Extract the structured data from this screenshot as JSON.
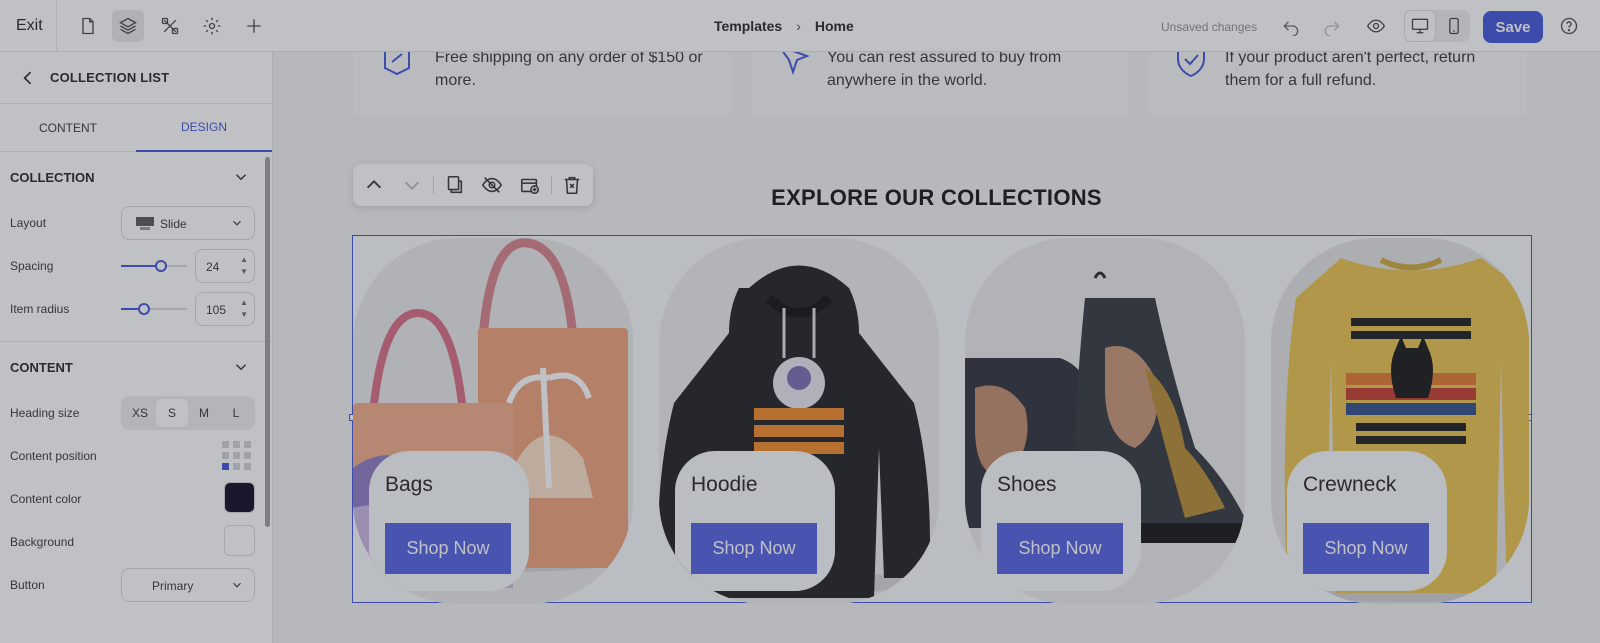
{
  "topbar": {
    "exit_label": "Exit",
    "breadcrumb": {
      "parent": "Templates",
      "current": "Home"
    },
    "unsaved_label": "Unsaved changes",
    "save_label": "Save",
    "help_label": "?"
  },
  "sidebar": {
    "title": "COLLECTION LIST",
    "tabs": [
      {
        "label": "CONTENT"
      },
      {
        "label": "DESIGN"
      }
    ],
    "collection_section": {
      "title": "COLLECTION",
      "layout": {
        "label": "Layout",
        "value": "Slide"
      },
      "spacing": {
        "label": "Spacing",
        "value": "24",
        "fraction": 0.6
      },
      "item_radius": {
        "label": "Item radius",
        "value": "105",
        "fraction": 0.35
      }
    },
    "content_section": {
      "title": "CONTENT",
      "heading_size": {
        "label": "Heading size",
        "options": [
          "XS",
          "S",
          "M",
          "L"
        ],
        "selected": "S"
      },
      "content_position": {
        "label": "Content position",
        "selected": "bottom-left"
      },
      "content_color": {
        "label": "Content color",
        "value": "#0b0620"
      },
      "background": {
        "label": "Background"
      },
      "button": {
        "label": "Button",
        "value": "Primary"
      }
    }
  },
  "canvas": {
    "features": [
      {
        "text_line1": "Free shipping on any order of $150 or",
        "text_line2": "more.",
        "icon": "shipping-icon"
      },
      {
        "text_line1": "You can rest assured to buy from",
        "text_line2": "anywhere in the world.",
        "icon": "plane-icon"
      },
      {
        "text_line1": "If your product aren't perfect, return",
        "text_line2": "them for a full refund.",
        "icon": "shield-check-icon"
      }
    ],
    "section_heading": "EXPLORE OUR COLLECTIONS",
    "collections": [
      {
        "name": "Bags",
        "button": "Shop Now"
      },
      {
        "name": "Hoodie",
        "button": "Shop Now"
      },
      {
        "name": "Shoes",
        "button": "Shop Now"
      },
      {
        "name": "Crewneck",
        "button": "Shop Now"
      }
    ]
  },
  "colors": {
    "accent": "#3f51d9",
    "button": "#4f5fe0",
    "content_swatch": "#0b0620"
  }
}
